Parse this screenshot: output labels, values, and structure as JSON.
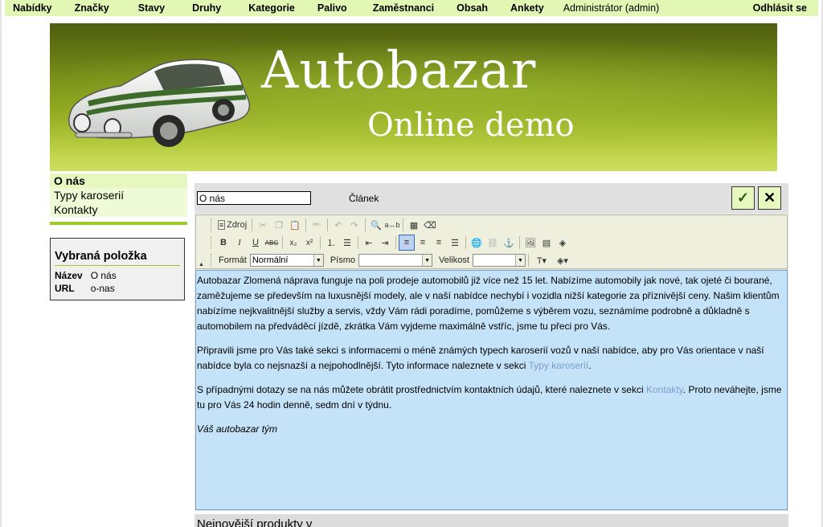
{
  "topnav": {
    "items": [
      "Nabídky",
      "Značky",
      "Stavy",
      "Druhy",
      "Kategorie",
      "Palivo",
      "Zaměstnanci",
      "Obsah",
      "Ankety"
    ],
    "admin": "Administrátor (admin)",
    "logout": "Odhlásit se"
  },
  "banner": {
    "title": "Autobazar",
    "subtitle": "Online demo"
  },
  "sidebar": {
    "items": [
      {
        "label": "O nás"
      },
      {
        "label": "Typy karoserií"
      },
      {
        "label": "Kontakty"
      }
    ]
  },
  "selected": {
    "heading": "Vybraná položka",
    "name_label": "Název",
    "name_value": "O nás",
    "url_label": "URL",
    "url_value": "o-nas"
  },
  "editor": {
    "title_value": "O nás",
    "type_label": "Článek",
    "confirm": "✓",
    "close": "✕",
    "toolbar": {
      "source_label": "Zdroj",
      "format_label": "Formát",
      "format_value": "Normální",
      "font_label": "Písmo",
      "font_value": "",
      "size_label": "Velikost",
      "size_value": ""
    },
    "content": {
      "p1": "Autobazar Zlomená náprava funguje na poli prodeje automobilů již více než 15 let. Nabízíme automobily jak nové, tak ojeté či bourané, zaměžujeme se především na luxusnější modely, ale v naší nabídce nechybí i vozidla nižší kategorie za příznivější ceny. Našim klientům nabízíme nejkvalitnější služby a servis, vždy Vám rádi poradíme, pomůžeme s výběrem vozu, seznámíme podrobně a důkladně s automobilem na předváděcí jízdě, zkrátka Vám vyjdeme maximálně vstříc, jsme tu přeci pro Vás.",
      "p2_before": "Připravili jsme pro Vás také sekci s informacemi o méně známých typech karoserií vozů v naší nabídce, aby pro Vás orientace v naší nabídce byla co nejsnazší a nejpohodlnější. Tyto informace naleznete v sekci ",
      "p2_link": "Typy karoserií",
      "p2_after": ".",
      "p3_before": "S případnými dotazy se na nás můžete obrátit prostřednictvím kontaktních údajů, které naleznete v sekci ",
      "p3_link": "Kontakty",
      "p3_after": ". Proto neváhejte, jsme tu pro Vás 24 hodin denně, sedm dní v týdnu.",
      "sign": "Váš autobazar tým"
    }
  },
  "bottom_heading": "Nejnovější produkty v"
}
